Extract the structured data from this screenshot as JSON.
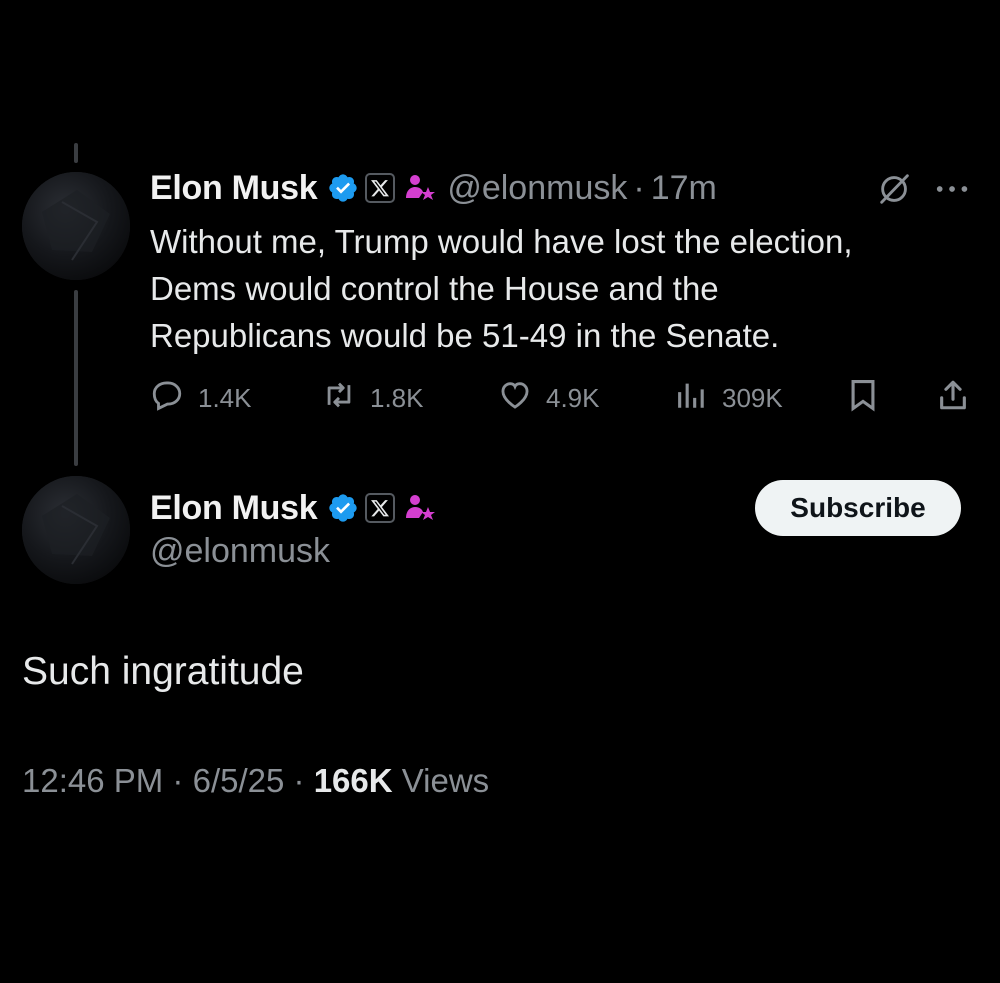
{
  "quoted_tweet": {
    "author_name": "Elon Musk",
    "handle": "@elonmusk",
    "separator": "·",
    "time_ago": "17m",
    "text_lines": [
      "Without me, Trump would have lost the election,",
      "Dems would control the House and the",
      "Republicans would be 51-49 in the Senate."
    ],
    "replies": "1.4K",
    "reposts": "1.8K",
    "likes": "4.9K",
    "views": "309K",
    "icons": [
      "grok-icon",
      "more-icon",
      "reply-icon",
      "repost-icon",
      "like-icon",
      "views-icon",
      "bookmark-icon",
      "share-icon"
    ]
  },
  "main_tweet": {
    "author_name": "Elon Musk",
    "handle": "@elonmusk",
    "subscribe_label": "Subscribe",
    "text": "Such ingratitude",
    "time": "12:46 PM",
    "separator": "·",
    "date": "6/5/25",
    "views_count": "166K",
    "views_label": "Views"
  },
  "colors": {
    "background": "#000000",
    "verified_blue": "#1d9bf0",
    "affiliate_magenta": "#d53fd0",
    "secondary_text": "#8b9096"
  }
}
